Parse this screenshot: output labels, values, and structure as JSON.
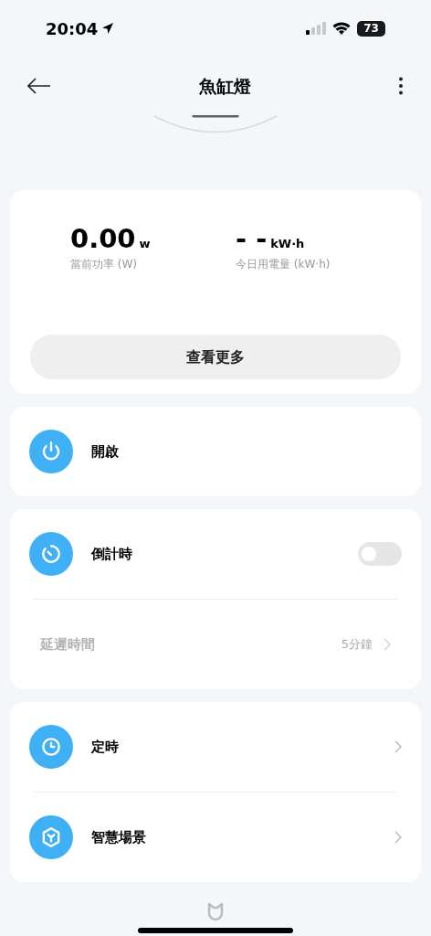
{
  "status_bar": {
    "time": "20:04",
    "battery": "73"
  },
  "header": {
    "title": "魚缸燈"
  },
  "stats": {
    "items": [
      {
        "value": "0.00",
        "unit": "w",
        "label": "當前功率 (W)"
      },
      {
        "value": "- -",
        "unit": "kW·h",
        "label": "今日用電量 (kW·h)"
      }
    ],
    "button": "查看更多"
  },
  "cards": [
    {
      "rows": [
        {
          "kind": "action",
          "label": "開啟"
        }
      ]
    },
    {
      "rows": [
        {
          "kind": "toggle",
          "label": "倒計時",
          "on": false
        },
        {
          "kind": "detail",
          "label": "延遲時間",
          "value": "5分鐘",
          "disabled": true
        }
      ]
    },
    {
      "rows": [
        {
          "kind": "link",
          "label": "定時"
        },
        {
          "kind": "link",
          "label": "智慧場景"
        }
      ]
    }
  ]
}
